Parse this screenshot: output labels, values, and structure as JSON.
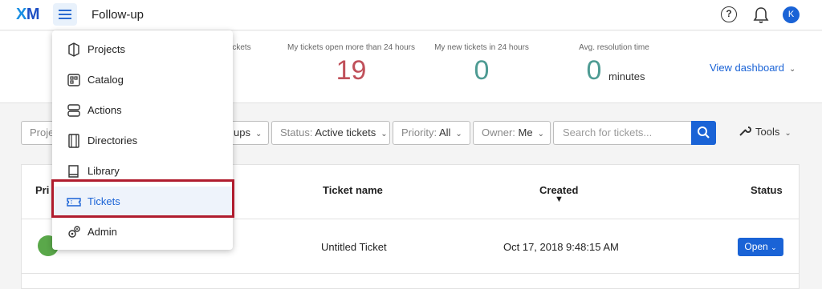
{
  "header": {
    "logo_x": "X",
    "logo_m": "M",
    "title": "Follow-up",
    "avatar_initial": "K"
  },
  "stats": [
    {
      "label": "e tickets",
      "value": ""
    },
    {
      "label": "My tickets open more than 24 hours",
      "value": "19",
      "color": "#c0505a"
    },
    {
      "label": "My new tickets in 24 hours",
      "value": "0",
      "color": "#4e9b93"
    },
    {
      "label": "Avg. resolution time",
      "value": "0",
      "unit": "minutes",
      "color": "#4e9b93"
    }
  ],
  "view_dashboard": "View dashboard",
  "filters": {
    "project_partial": "Proje",
    "groups_partial": "ups",
    "status_label": "Status:",
    "status_value": "Active tickets",
    "priority_label": "Priority:",
    "priority_value": "All",
    "owner_label": "Owner:",
    "owner_value": "Me",
    "search_placeholder": "Search for tickets...",
    "tools_label": "Tools"
  },
  "table": {
    "headers": {
      "priority_partial": "Pri",
      "ticket_name": "Ticket name",
      "created": "Created",
      "status": "Status"
    },
    "rows": [
      {
        "ticket_name": "Untitled Ticket",
        "created": "Oct 17, 2018 9:48:15 AM",
        "status": "Open"
      }
    ]
  },
  "menu": {
    "items": [
      {
        "label": "Projects",
        "icon": "projects-icon"
      },
      {
        "label": "Catalog",
        "icon": "catalog-icon"
      },
      {
        "label": "Actions",
        "icon": "actions-icon"
      },
      {
        "label": "Directories",
        "icon": "directories-icon"
      },
      {
        "label": "Library",
        "icon": "library-icon"
      },
      {
        "label": "Tickets",
        "icon": "tickets-icon",
        "active": true
      },
      {
        "label": "Admin",
        "icon": "admin-icon"
      }
    ]
  },
  "colors": {
    "accent": "#1a63d6",
    "highlight": "#b01c2e",
    "priority_green": "#5aa84a"
  }
}
